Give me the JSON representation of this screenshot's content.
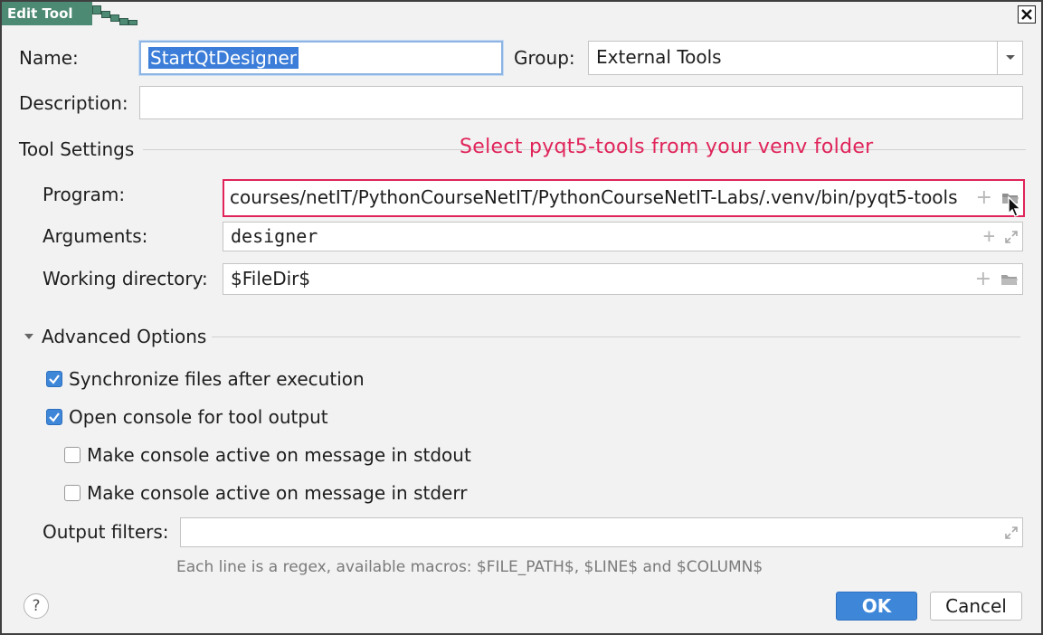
{
  "window": {
    "title": "Edit Tool"
  },
  "name": {
    "label": "Name:",
    "value": "StartQtDesigner"
  },
  "group": {
    "label": "Group:",
    "value": "External Tools"
  },
  "description": {
    "label": "Description:",
    "value": ""
  },
  "tool_settings": {
    "title": "Tool Settings",
    "annotation": "Select pyqt5-tools from your venv folder",
    "program": {
      "label": "Program:",
      "value": "courses/netIT/PythonCourseNetIT/PythonCourseNetIT-Labs/.venv/bin/pyqt5-tools"
    },
    "arguments": {
      "label": "Arguments:",
      "value": "designer"
    },
    "working_directory": {
      "label": "Working directory:",
      "value": "$FileDir$"
    }
  },
  "advanced": {
    "title": "Advanced Options",
    "options": [
      {
        "label": "Synchronize files after execution",
        "checked": true
      },
      {
        "label": "Open console for tool output",
        "checked": true
      },
      {
        "label": "Make console active on message in stdout",
        "checked": false
      },
      {
        "label": "Make console active on message in stderr",
        "checked": false
      }
    ],
    "output_filters": {
      "label": "Output filters:",
      "value": ""
    },
    "hint": "Each line is a regex, available macros: $FILE_PATH$, $LINE$ and $COLUMN$"
  },
  "buttons": {
    "help": "?",
    "ok": "OK",
    "cancel": "Cancel"
  },
  "colors": {
    "accent": "#3e86d8",
    "annotation": "#e0245a",
    "title_bar": "#4d8a73"
  }
}
